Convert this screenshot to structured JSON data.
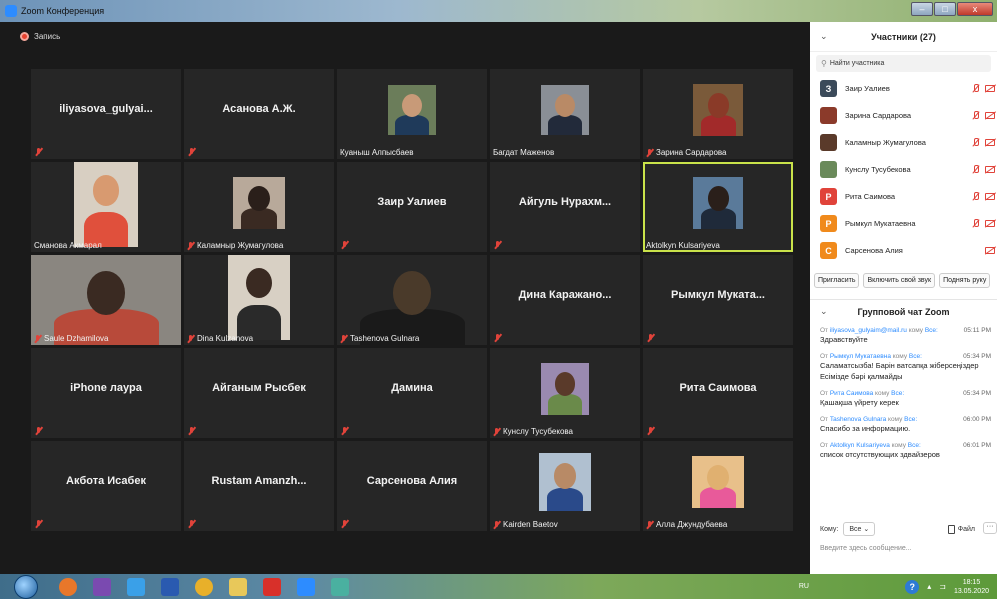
{
  "window": {
    "title": "Zoom Конференция",
    "minimize": "–",
    "maximize": "□",
    "close": "x"
  },
  "recording": {
    "label": "Запись"
  },
  "tiles": [
    {
      "name": "iliyasova_gulyai...",
      "style": "big",
      "muted": true
    },
    {
      "name": "Асанова А.Ж.",
      "style": "big",
      "muted": true
    },
    {
      "name": "Куаныш Алпысбаев",
      "style": "video",
      "muted": false,
      "photo": "man1"
    },
    {
      "name": "Багдат Маженов",
      "style": "video",
      "muted": false,
      "photo": "man2"
    },
    {
      "name": "Зарина Сардарова",
      "style": "video",
      "muted": true,
      "photo": "woman1"
    },
    {
      "name": "Сманова Акмарал",
      "style": "video",
      "muted": false,
      "photo": "woman2"
    },
    {
      "name": "Каламныр Жумагулова",
      "style": "video",
      "muted": true,
      "photo": "woman3"
    },
    {
      "name": "Заир Уалиев",
      "style": "big",
      "muted": true
    },
    {
      "name": "Айгуль Нурахм...",
      "style": "big",
      "muted": true
    },
    {
      "name": "Aktolkyn Kulsariyeva",
      "style": "video",
      "muted": false,
      "photo": "woman4",
      "active": true
    },
    {
      "name": "Saule Dzhamilova",
      "style": "video",
      "muted": true,
      "photo": "woman5"
    },
    {
      "name": "Dina Kulzanova",
      "style": "video",
      "muted": true,
      "photo": "woman6"
    },
    {
      "name": "Tashenova Gulnara",
      "style": "video",
      "muted": true,
      "photo": "woman7"
    },
    {
      "name": "Дина Каражано...",
      "style": "big",
      "muted": true
    },
    {
      "name": "Рымкул Муката...",
      "style": "big",
      "muted": true
    },
    {
      "name": "iPhone лаура",
      "style": "big",
      "muted": true
    },
    {
      "name": "Айганым Рысбек",
      "style": "big",
      "muted": true
    },
    {
      "name": "Дамина",
      "style": "big",
      "muted": true
    },
    {
      "name": "Кунслу Тусубекова",
      "style": "video",
      "muted": true,
      "photo": "woman8"
    },
    {
      "name": "Рита Саимова",
      "style": "big",
      "muted": true
    },
    {
      "name": "Акбота Исабек",
      "style": "big",
      "muted": true
    },
    {
      "name": "Rustam Amanzh...",
      "style": "big",
      "muted": true
    },
    {
      "name": "Сарсенова Алия",
      "style": "big",
      "muted": true
    },
    {
      "name": "Kairden Baetov",
      "style": "video",
      "muted": true,
      "photo": "man3"
    },
    {
      "name": "Алла Джундубаева",
      "style": "video",
      "muted": true,
      "photo": "woman9"
    }
  ],
  "participants": {
    "title": "Участники (27)",
    "search_placeholder": "Найти участника",
    "list": [
      {
        "initial": "З",
        "name": "Заир Уалиев",
        "color": "#3b4a5a",
        "mic_muted": true,
        "cam_off": true
      },
      {
        "initial": "",
        "name": "Зарина Сардарова",
        "color": "#8b3a2a",
        "mic_muted": true,
        "cam_off": true
      },
      {
        "initial": "",
        "name": "Каламныр Жумагулова",
        "color": "#5a3a2a",
        "mic_muted": true,
        "cam_off": true
      },
      {
        "initial": "",
        "name": "Кунслу Тусубекова",
        "color": "#6a8a5a",
        "mic_muted": true,
        "cam_off": true
      },
      {
        "initial": "Р",
        "name": "Рита Саимова",
        "color": "#e0433a",
        "mic_muted": true,
        "cam_off": true
      },
      {
        "initial": "Р",
        "name": "Рымкул Мукатаевна",
        "color": "#f08a1c",
        "mic_muted": true,
        "cam_off": true
      },
      {
        "initial": "С",
        "name": "Сарсенова Алия",
        "color": "#f08a1c",
        "mic_muted": false,
        "cam_off": true
      }
    ],
    "buttons": [
      "Пригласить",
      "Включить свой звук",
      "Поднять руку"
    ]
  },
  "chat": {
    "title": "Групповой чат Zoom",
    "messages": [
      {
        "from": "iliyasova_gulyaim@mail.ru",
        "to": "Все",
        "time": "05:11 PM",
        "text": "Здравствуйте"
      },
      {
        "from": "Рымкул Мукатаевна",
        "to": "Все",
        "time": "05:34 PM",
        "text": "Саламатсызба! Барін ватсапқа жіберсеңіздер Есімізде бәрі қалмайды"
      },
      {
        "from": "Рита Саимова",
        "to": "Все",
        "time": "05:34 PM",
        "text": "Қашақша үйрету керек"
      },
      {
        "from": "Tashenova Gulnara",
        "to": "Все",
        "time": "06:00 PM",
        "text": "Спасибо за информацию."
      },
      {
        "from": "Aktolkyn Kulsariyeva",
        "to": "Все",
        "time": "06:01 PM",
        "text": "список отсутствующих здвайзеров"
      }
    ],
    "from_prefix": "От",
    "to_word": "кому",
    "to_label": "Кому:",
    "to_value": "Все",
    "file_label": "Файл",
    "more": "···",
    "input_placeholder": "Введите здесь сообщение..."
  },
  "taskbar": {
    "lang": "RU",
    "time": "18:15",
    "date": "13.05.2020",
    "apps": [
      "firefox",
      "winamp",
      "ie",
      "word",
      "chrome",
      "explorer",
      "acrobat",
      "zoom",
      "paint"
    ]
  }
}
